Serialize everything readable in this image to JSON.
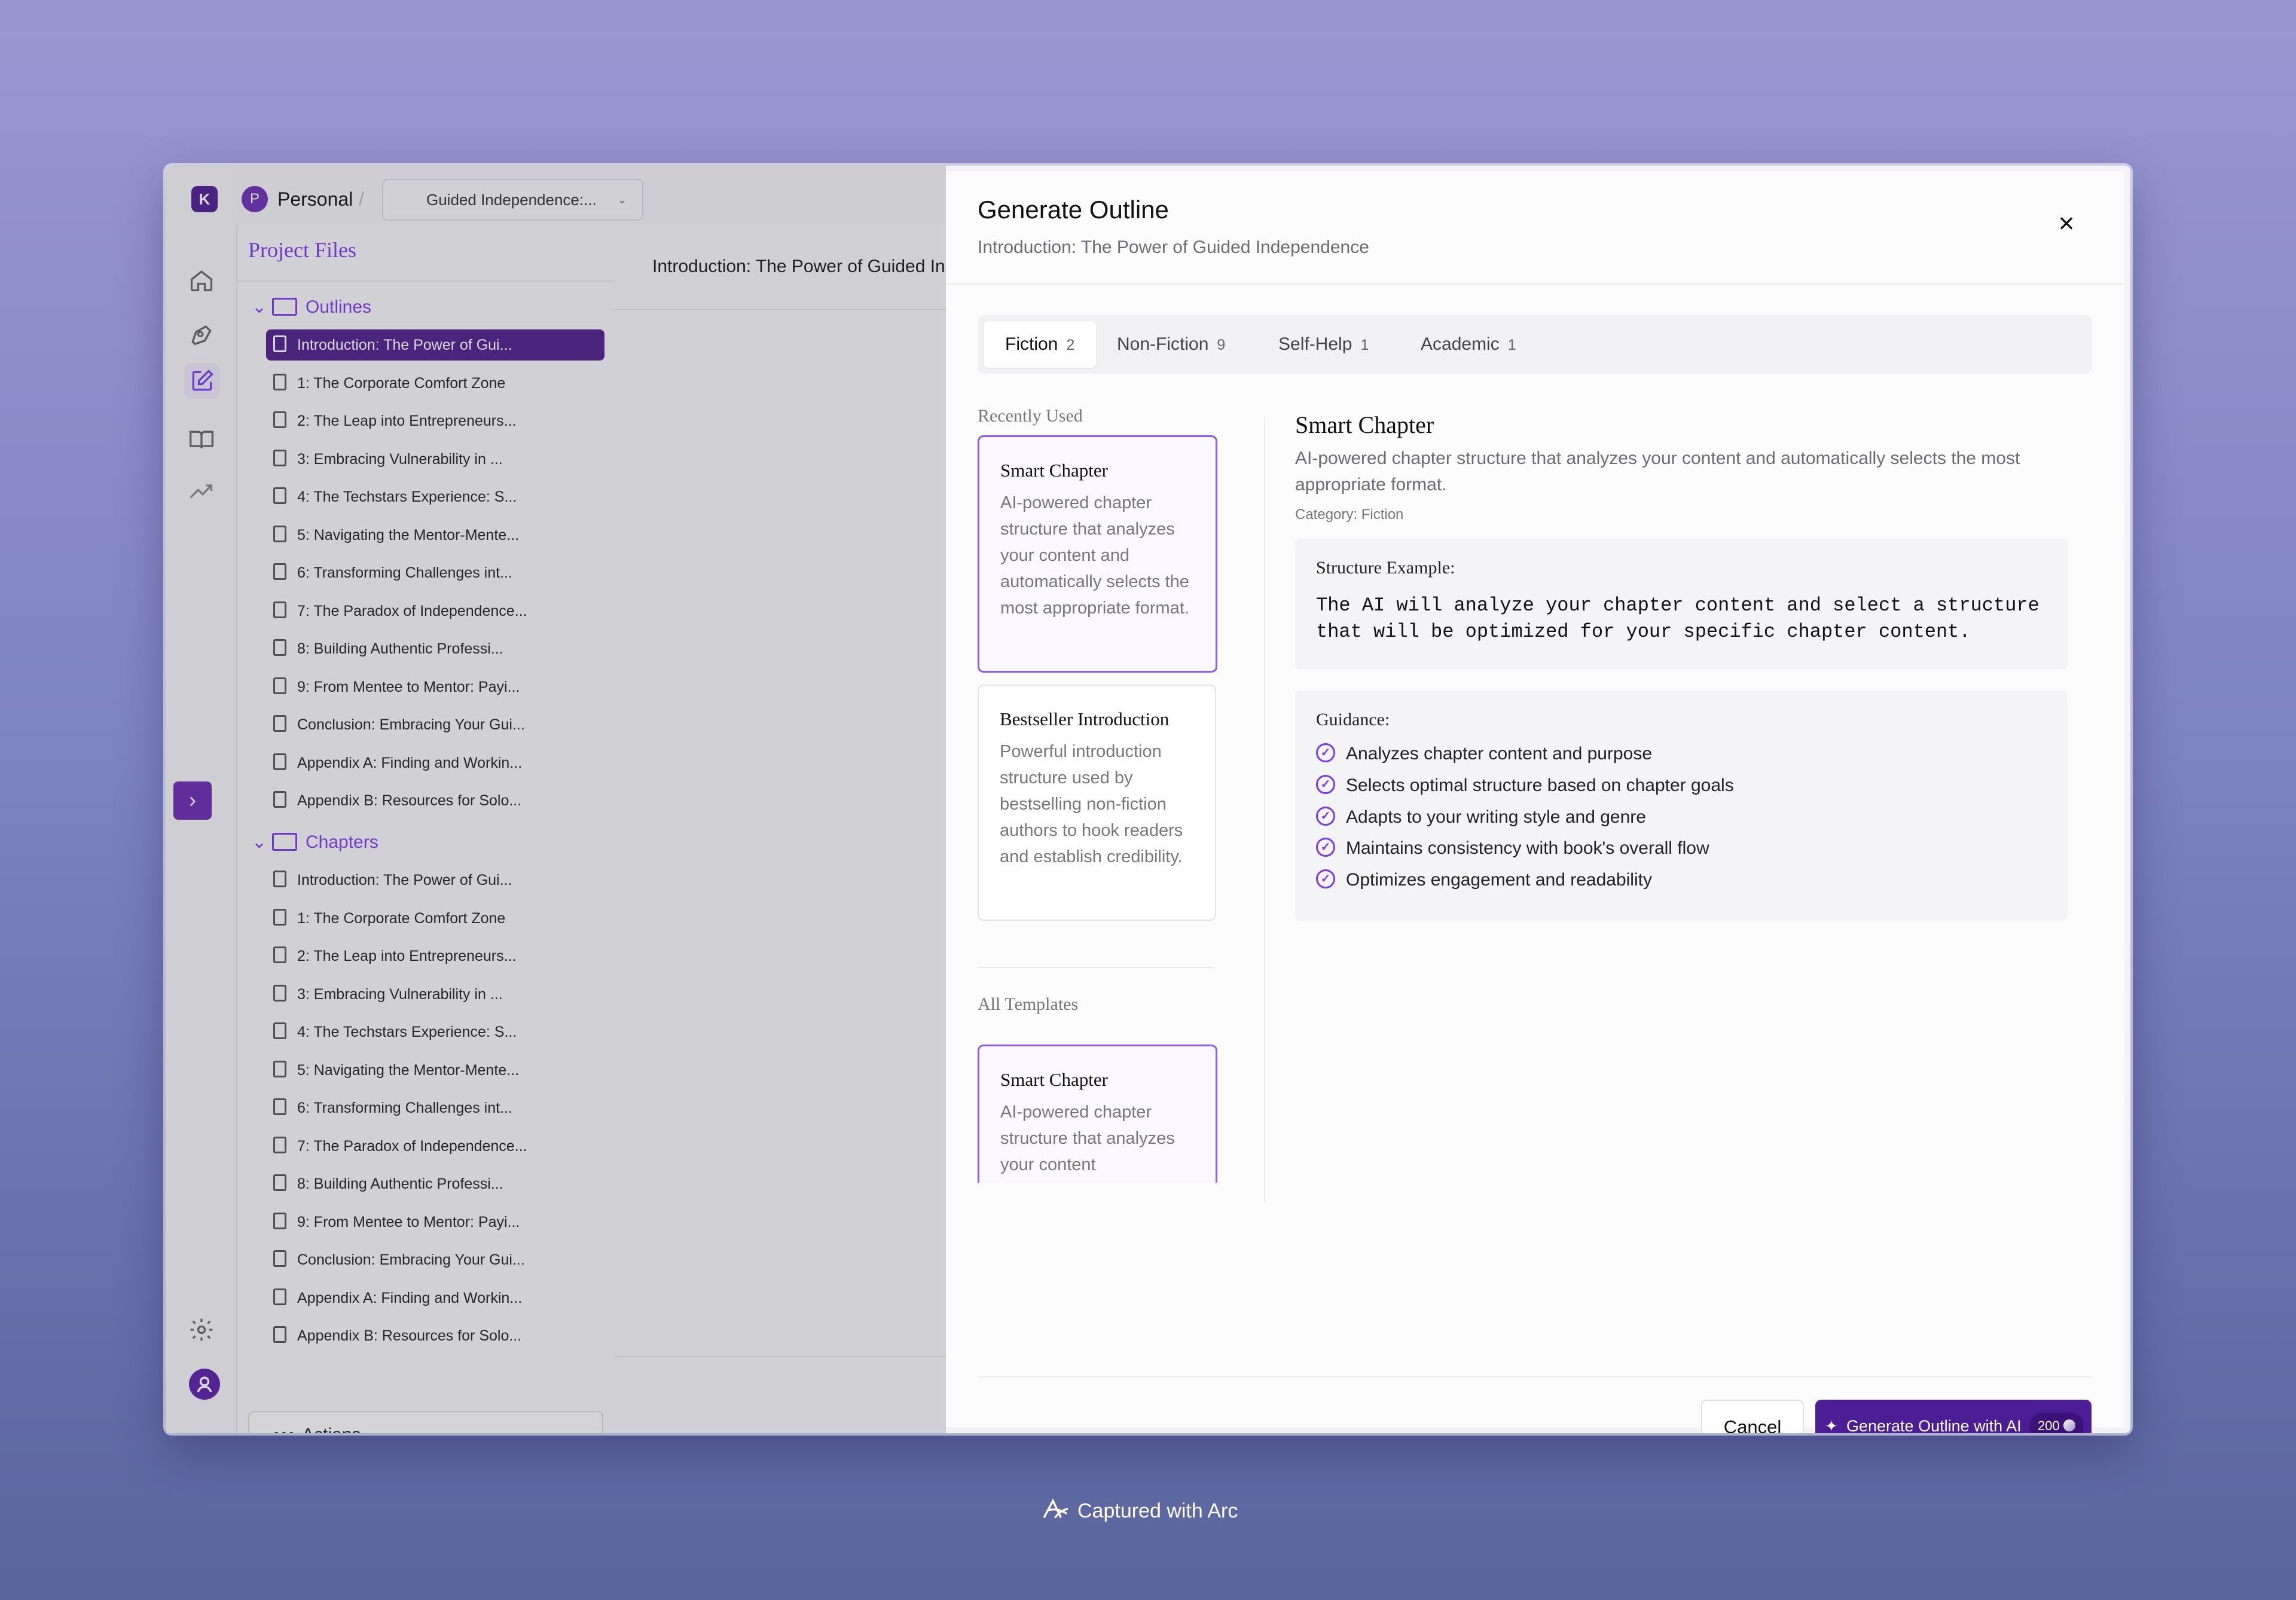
{
  "app": {
    "logo_letter": "K",
    "workspace": {
      "initial": "P",
      "name": "Personal"
    },
    "breadcrumb_sep": "/",
    "project_select": "Guided Independence:..."
  },
  "rail": {
    "icons": [
      "home-icon",
      "pen-icon",
      "edit-icon",
      "book-icon",
      "trending-icon"
    ],
    "expand_glyph": "›",
    "settings": "gear-icon",
    "user": "user-icon"
  },
  "files": {
    "title": "Project Files",
    "outlines_label": "Outlines",
    "chapters_label": "Chapters",
    "outlines": [
      "Introduction: The Power of Gui...",
      "1: The Corporate Comfort Zone",
      "2: The Leap into Entrepreneurs...",
      "3: Embracing Vulnerability in ...",
      "4: The Techstars Experience: S...",
      "5: Navigating the Mentor-Mente...",
      "6: Transforming Challenges int...",
      "7: The Paradox of Independence...",
      "8: Building Authentic Professi...",
      "9: From Mentee to Mentor: Payi...",
      "Conclusion: Embracing Your Gui...",
      "Appendix A: Finding and Workin...",
      "Appendix B: Resources for Solo..."
    ],
    "chapters": [
      "Introduction: The Power of Gui...",
      "1: The Corporate Comfort Zone",
      "2: The Leap into Entrepreneurs...",
      "3: Embracing Vulnerability in ...",
      "4: The Techstars Experience: S...",
      "5: Navigating the Mentor-Mente...",
      "6: Transforming Challenges int...",
      "7: The Paradox of Independence...",
      "8: Building Authentic Professi...",
      "9: From Mentee to Mentor: Payi...",
      "Conclusion: Embracing Your Gui...",
      "Appendix A: Finding and Workin...",
      "Appendix B: Resources for Solo..."
    ],
    "actions_dots": "•••",
    "actions_label": "Actions"
  },
  "editor": {
    "title": "Introduction: The Power of Guided Independence"
  },
  "modal": {
    "title": "Generate Outline",
    "subtitle": "Introduction: The Power of Guided Independence",
    "close": "×",
    "tabs": [
      {
        "label": "Fiction",
        "count": "2"
      },
      {
        "label": "Non-Fiction",
        "count": "9"
      },
      {
        "label": "Self-Help",
        "count": "1"
      },
      {
        "label": "Academic",
        "count": "1"
      }
    ],
    "recently_used_label": "Recently Used",
    "all_templates_label": "All Templates",
    "recent_cards": [
      {
        "title": "Smart Chapter",
        "desc": "AI-powered chapter structure that analyzes your content and automatically selects the most appropriate format."
      },
      {
        "title": "Bestseller Introduction",
        "desc": "Powerful introduction structure used by bestselling non-fiction authors to hook readers and establish credibility."
      }
    ],
    "all_cards": [
      {
        "title": "Smart Chapter",
        "desc": "AI-powered chapter structure that analyzes your content"
      }
    ],
    "detail": {
      "title": "Smart Chapter",
      "desc": "AI-powered chapter structure that analyzes your content and automatically selects the most appropriate format.",
      "category": "Category: Fiction",
      "structure_label": "Structure Example:",
      "structure_text": "The AI will analyze your chapter content and select a structure that will be optimized for your specific chapter content.",
      "guidance_label": "Guidance:",
      "guidance": [
        "Analyzes chapter content and purpose",
        "Selects optimal structure based on chapter goals",
        "Adapts to your writing style and genre",
        "Maintains consistency with book's overall flow",
        "Optimizes engagement and readability"
      ]
    },
    "cancel": "Cancel",
    "generate": "Generate Outline with AI",
    "credits": "200"
  },
  "footer": {
    "text": "Captured with Arc"
  },
  "colors": {
    "accent": "#7c3aed",
    "primary_button": "#4c1d95",
    "selected_file": "#4e1f8b"
  }
}
